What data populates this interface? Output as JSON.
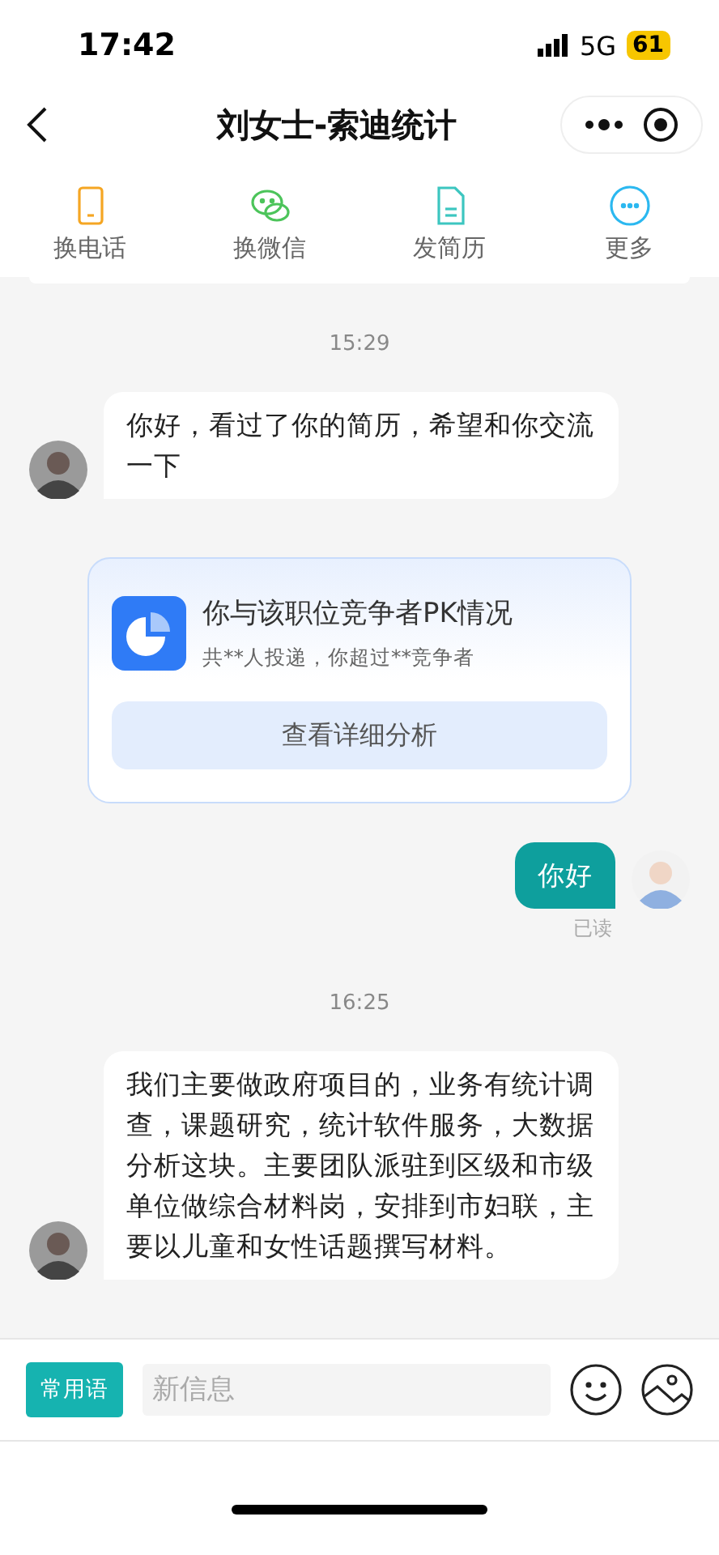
{
  "status_bar": {
    "time": "17:42",
    "network": "5G",
    "battery": "61"
  },
  "header": {
    "title": "刘女士-索迪统计"
  },
  "actions": [
    {
      "label": "换电话",
      "kind": "phone"
    },
    {
      "label": "换微信",
      "kind": "wechat"
    },
    {
      "label": "发简历",
      "kind": "resume"
    },
    {
      "label": "更多",
      "kind": "more"
    }
  ],
  "messages": [
    {
      "kind": "cut_card"
    },
    {
      "kind": "time",
      "text": "15:29"
    },
    {
      "kind": "incoming",
      "text": "你好，看过了你的简历，希望和你交流一下"
    },
    {
      "kind": "card",
      "title": "你与该职位竞争者PK情况",
      "subtitle": "共**人投递，你超过**竞争者",
      "button": "查看详细分析"
    },
    {
      "kind": "outgoing",
      "text": "你好",
      "status": "已读"
    },
    {
      "kind": "time",
      "text": "16:25"
    },
    {
      "kind": "incoming",
      "text": "我们主要做政府项目的，业务有统计调查，课题研究，统计软件服务，大数据分析这块。主要团队派驻到区级和市级单位做综合材料岗，安排到市妇联，主要以儿童和女性话题撰写材料。"
    }
  ],
  "composer": {
    "phrases": "常用语",
    "placeholder": "新信息"
  }
}
